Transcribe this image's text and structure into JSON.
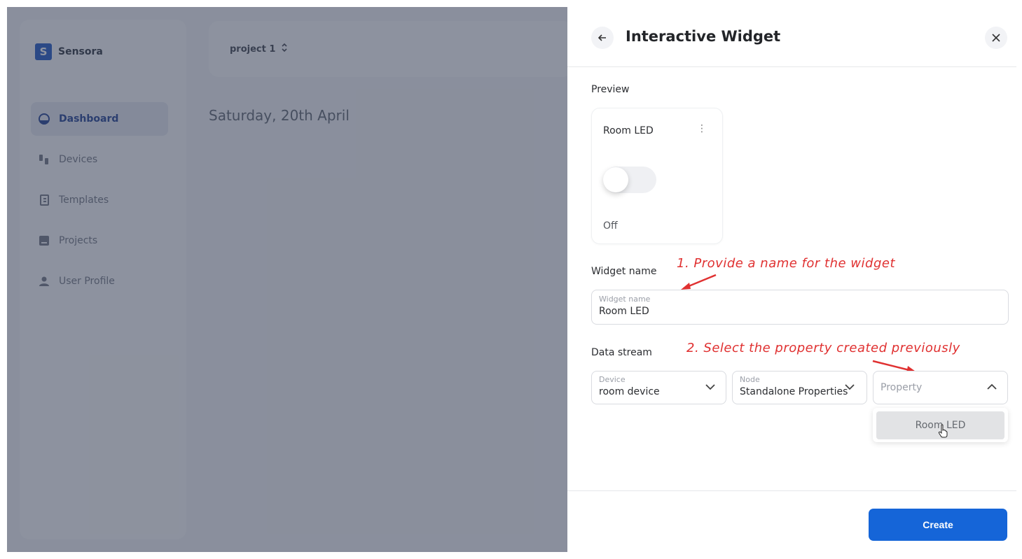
{
  "background_app": {
    "brand": {
      "name": "Sensora",
      "logo_letter": "S"
    },
    "nav": [
      {
        "label": "Dashboard",
        "icon": "dashboard-icon",
        "active": true
      },
      {
        "label": "Devices",
        "icon": "devices-icon",
        "active": false
      },
      {
        "label": "Templates",
        "icon": "templates-icon",
        "active": false
      },
      {
        "label": "Projects",
        "icon": "projects-icon",
        "active": false
      },
      {
        "label": "User Profile",
        "icon": "user-icon",
        "active": false
      }
    ],
    "project_selector": {
      "label": "project 1",
      "icon": "unfold-icon"
    },
    "date_heading": "Saturday, 20th April"
  },
  "drawer": {
    "title": "Interactive Widget",
    "back_icon": "arrow-left-icon",
    "close_icon": "close-icon",
    "preview_label": "Preview",
    "preview_card": {
      "title": "Room LED",
      "menu_icon": "kebab-menu-icon",
      "toggle_on": false,
      "state_text": "Off"
    },
    "widget_name": {
      "section_label": "Widget name",
      "field_label": "Widget name",
      "value": "Room LED"
    },
    "data_stream": {
      "section_label": "Data stream",
      "device": {
        "label": "Device",
        "value": "room device"
      },
      "node": {
        "label": "Node",
        "value": "Standalone Properties"
      },
      "property": {
        "placeholder": "Property",
        "open": true,
        "options": [
          "Room LED"
        ]
      }
    },
    "create_label": "Create",
    "accent_color": "#1565d8"
  },
  "annotations": {
    "step1": "1. Provide a name for the widget",
    "step2": "2. Select the property created previously",
    "color": "#e03131"
  }
}
